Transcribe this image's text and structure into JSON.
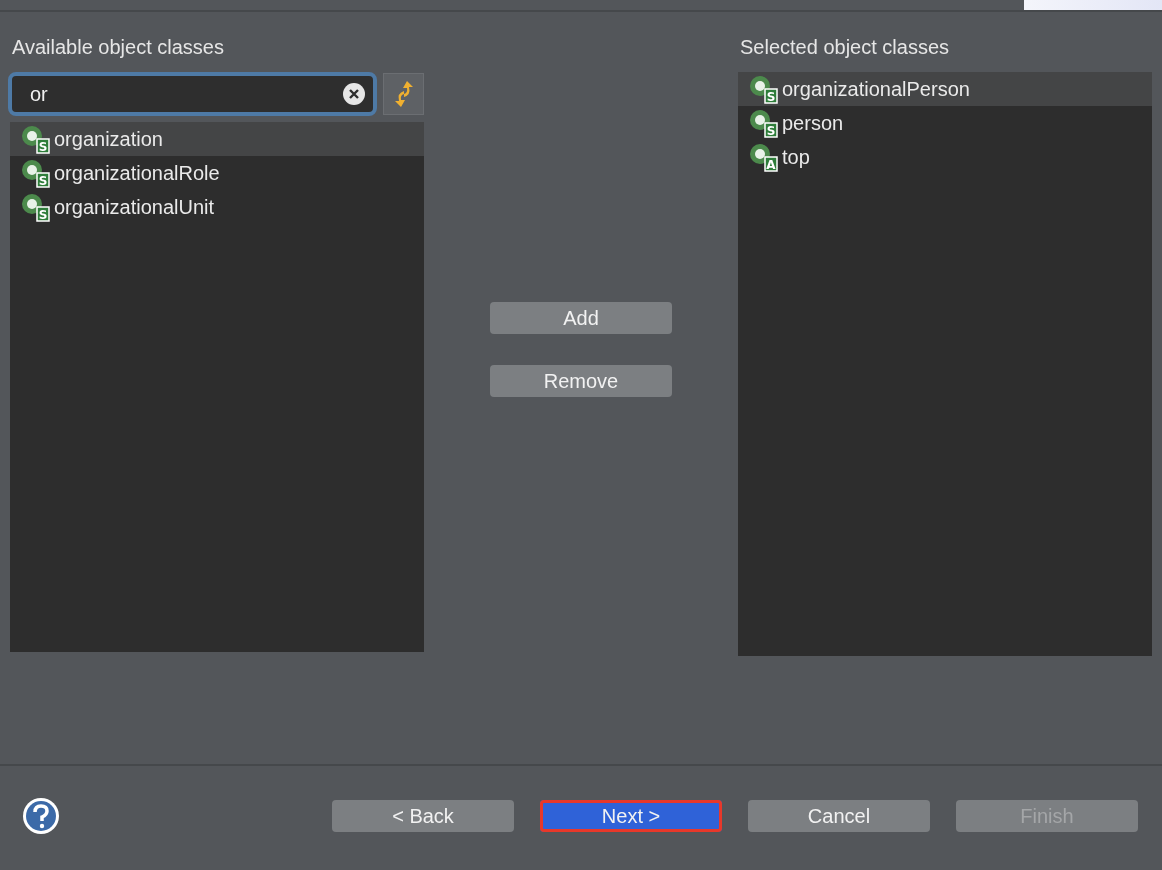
{
  "available": {
    "title": "Available object classes",
    "search": {
      "value": "or"
    },
    "items": [
      {
        "label": "organization",
        "badge": "S",
        "selected": true
      },
      {
        "label": "organizationalRole",
        "badge": "S",
        "selected": false
      },
      {
        "label": "organizationalUnit",
        "badge": "S",
        "selected": false
      }
    ]
  },
  "actions": [
    "Add",
    "Remove"
  ],
  "selected_classes": {
    "title": "Selected object classes",
    "items": [
      {
        "label": "organizationalPerson",
        "badge": "S",
        "selected": true
      },
      {
        "label": "person",
        "badge": "S",
        "selected": false
      },
      {
        "label": "top",
        "badge": "A",
        "selected": false
      }
    ]
  },
  "footer": {
    "buttons": [
      {
        "label": "< Back",
        "default": false,
        "disabled": false,
        "highlighted": false
      },
      {
        "label": "Next >",
        "default": true,
        "disabled": false,
        "highlighted": true
      },
      {
        "label": "Cancel",
        "default": false,
        "disabled": false,
        "highlighted": false
      },
      {
        "label": "Finish",
        "default": false,
        "disabled": true,
        "highlighted": false
      }
    ]
  }
}
